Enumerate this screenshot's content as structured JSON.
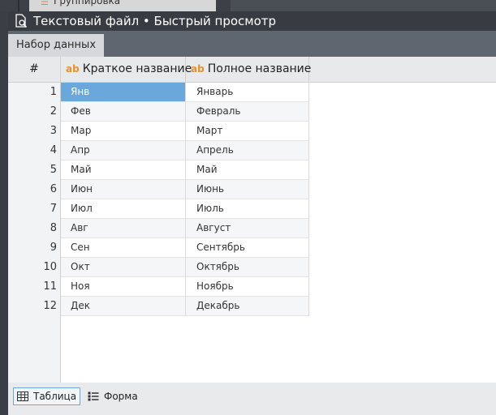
{
  "background": {
    "panel_item_label": "Группировка"
  },
  "window": {
    "title": "Текстовый файл • Быстрый просмотр"
  },
  "tabs": [
    {
      "label": "Набор данных",
      "active": true
    }
  ],
  "table": {
    "columns": [
      {
        "label": "#"
      },
      {
        "label": "Краткое название",
        "type_badge": "ab"
      },
      {
        "label": "Полное название",
        "type_badge": "ab"
      }
    ],
    "rows": [
      {
        "n": "1",
        "short": "Янв",
        "full": "Январь"
      },
      {
        "n": "2",
        "short": "Фев",
        "full": "Февраль"
      },
      {
        "n": "3",
        "short": "Мар",
        "full": "Март"
      },
      {
        "n": "4",
        "short": "Апр",
        "full": "Апрель"
      },
      {
        "n": "5",
        "short": "Май",
        "full": "Май"
      },
      {
        "n": "6",
        "short": "Июн",
        "full": "Июнь"
      },
      {
        "n": "7",
        "short": "Июл",
        "full": "Июль"
      },
      {
        "n": "8",
        "short": "Авг",
        "full": "Август"
      },
      {
        "n": "9",
        "short": "Сен",
        "full": "Сентябрь"
      },
      {
        "n": "10",
        "short": "Окт",
        "full": "Октябрь"
      },
      {
        "n": "11",
        "short": "Ноя",
        "full": "Ноябрь"
      },
      {
        "n": "12",
        "short": "Дек",
        "full": "Декабрь"
      }
    ],
    "selected_row": 1
  },
  "bottom": {
    "table_button": "Таблица",
    "form_button": "Форма"
  },
  "colors": {
    "accent": "#6aa8dc",
    "badge": "#e8902a",
    "titlebar": "#383c42"
  }
}
